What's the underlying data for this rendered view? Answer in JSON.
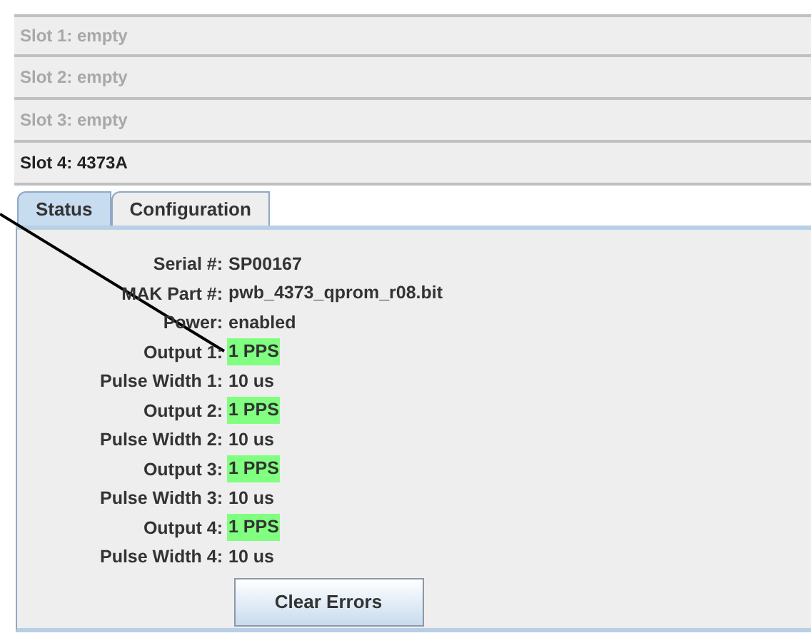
{
  "slots": [
    {
      "label": "Slot 1: empty",
      "disabled": true
    },
    {
      "label": "Slot 2: empty",
      "disabled": true
    },
    {
      "label": "Slot 3: empty",
      "disabled": true
    },
    {
      "label": "Slot 4: 4373A",
      "disabled": false
    }
  ],
  "tabs": [
    {
      "label": "Status",
      "selected": true
    },
    {
      "label": "Configuration",
      "selected": false
    }
  ],
  "fields": [
    {
      "label": "Serial #:",
      "value": "SP00167",
      "highlighted": false
    },
    {
      "label": "MAK Part #:",
      "value": "pwb_4373_qprom_r08.bit",
      "highlighted": false
    },
    {
      "label": "Power:",
      "value": "enabled",
      "highlighted": false
    },
    {
      "label": "Output 1:",
      "value": "1 PPS",
      "highlighted": true
    },
    {
      "label": "Pulse Width 1:",
      "value": "10 us",
      "highlighted": false
    },
    {
      "label": "Output 2:",
      "value": "1 PPS",
      "highlighted": true
    },
    {
      "label": "Pulse Width 2:",
      "value": "10 us",
      "highlighted": false
    },
    {
      "label": "Output 3:",
      "value": "1 PPS",
      "highlighted": true
    },
    {
      "label": "Pulse Width 3:",
      "value": "10 us",
      "highlighted": false
    },
    {
      "label": "Output 4:",
      "value": "1 PPS",
      "highlighted": true
    },
    {
      "label": "Pulse Width 4:",
      "value": "10 us",
      "highlighted": false
    }
  ],
  "button": "Clear Errors"
}
